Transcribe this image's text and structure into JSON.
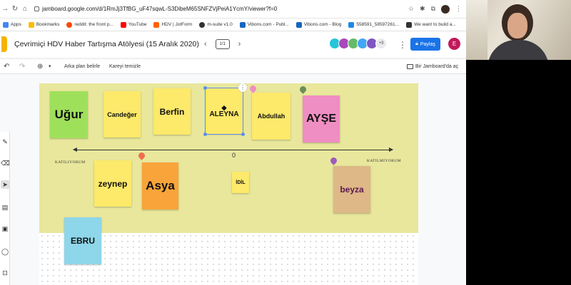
{
  "browser": {
    "url": "jamboard.google.com/d/1RmJj3TfBG_uF47sqwL-S3DibeM65SNFZVjPeiA1YcmY/viewer?f=0",
    "bookmarks": [
      {
        "label": "Apps",
        "color": "#4285f4"
      },
      {
        "label": "Bookmarks",
        "color": "#fbbc05"
      },
      {
        "label": "reddit: the front p...",
        "color": "#ff4500"
      },
      {
        "label": "YouTube",
        "color": "#ff0000"
      },
      {
        "label": "HDV | JotForm",
        "color": "#ff6100"
      },
      {
        "label": "m-suite v1.0",
        "color": "#333333"
      },
      {
        "label": "Vibons.com - Publ...",
        "color": "#1565c0"
      },
      {
        "label": "Vibons.com - Blog",
        "color": "#1565c0"
      },
      {
        "label": "558591_58597261...",
        "color": "#1e88e5"
      },
      {
        "label": "We want to build a...",
        "color": "#333333"
      }
    ]
  },
  "header": {
    "title": "Çevrimiçi HDV Haber Tartışma Atölyesi (15 Aralık 2020)",
    "page": "1/1",
    "more_count": "+9",
    "share_label": "Paylaş",
    "user_initial": "E"
  },
  "toolbar": {
    "background_label": "Arka plan belirle",
    "clear_label": "Kareyi temizle",
    "cast_label": "Bir Jamboard'da aç"
  },
  "board": {
    "left_label": "KATILIYORUM",
    "right_label": "KATILMIYORUM",
    "center_label": "0",
    "notes": [
      {
        "text": "Uğur",
        "color": "#9fe05b"
      },
      {
        "text": "Candeğer",
        "color": "#fde96a"
      },
      {
        "text": "Berfin",
        "color": "#fde96a"
      },
      {
        "text": "ALEYNA",
        "color": "#fde96a"
      },
      {
        "text": "Abdullah",
        "color": "#fde96a"
      },
      {
        "text": "AYŞE",
        "color": "#ef8ec2"
      },
      {
        "text": "zeynep",
        "color": "#fde96a"
      },
      {
        "text": "Asya",
        "color": "#f9a43a"
      },
      {
        "text": "İDİL",
        "color": "#fde96a"
      },
      {
        "text": "beyza",
        "color": "#deb887"
      },
      {
        "text": "EBRU",
        "color": "#8ed6ea"
      }
    ]
  },
  "colors": {
    "board_background": "#e8e79c",
    "accent": "#1a73e8"
  }
}
